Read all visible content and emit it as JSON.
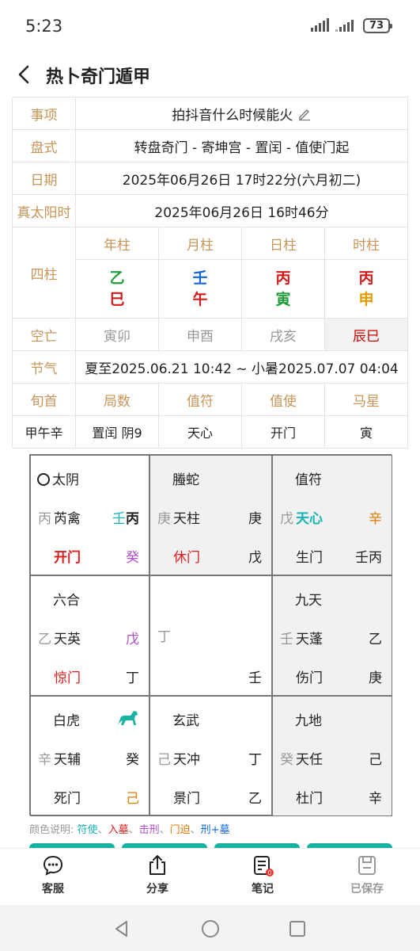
{
  "status": {
    "time": "5:23",
    "battery": "73"
  },
  "header": {
    "title": "热卜奇门遁甲"
  },
  "info": {
    "matter_label": "事项",
    "matter_value": "拍抖音什么时候能火",
    "layout_label": "盘式",
    "layout_value": "转盘奇门 - 寄坤宫 - 置闰 - 值使门起",
    "date_label": "日期",
    "date_value": "2025年06月26日 17时22分(六月初二)",
    "solar_label": "真太阳时",
    "solar_value": "2025年06月26日 16时46分",
    "pillars_label": "四柱",
    "pillar_heads": [
      "年柱",
      "月柱",
      "日柱",
      "时柱"
    ],
    "pillar_stems": [
      "乙",
      "壬",
      "丙",
      "丙"
    ],
    "pillar_branches": [
      "巳",
      "午",
      "寅",
      "申"
    ],
    "void_label": "空亡",
    "voids": [
      "寅卯",
      "申酉",
      "戌亥",
      "辰巳"
    ],
    "term_label": "节气",
    "term_value": "夏至2025.06.21 10:42 ~ 小暑2025.07.07 04:04",
    "lead_label": "旬首",
    "ju_label": "局数",
    "zhifu_label": "值符",
    "zhishi_label": "值使",
    "horse_label": "马星",
    "lead_value": "甲午辛",
    "ju_value": "置闰 阴9",
    "zhifu_value": "天心",
    "zhishi_value": "开门",
    "horse_value": "寅"
  },
  "board": {
    "c1": {
      "god": "太阴",
      "tg": "丙",
      "star": "芮禽",
      "tr1": "壬",
      "tr2": "丙",
      "door": "开门",
      "br": "癸"
    },
    "c2": {
      "god": "螣蛇",
      "tg": "庚",
      "star": "天柱",
      "tr": "庚",
      "door": "休门",
      "br": "戊"
    },
    "c3": {
      "god": "值符",
      "tg": "戊",
      "star": "天心",
      "tr": "辛",
      "door": "生门",
      "br": "壬丙"
    },
    "c4": {
      "god": "六合",
      "tg": "乙",
      "star": "天英",
      "tr": "戊",
      "door": "惊门",
      "br": "丁"
    },
    "c5": {
      "tg": "丁",
      "br": "壬"
    },
    "c6": {
      "god": "九天",
      "tg": "壬",
      "star": "天蓬",
      "tr": "乙",
      "door": "伤门",
      "br": "庚"
    },
    "c7": {
      "god": "白虎",
      "tg": "辛",
      "star": "天辅",
      "tr": "癸",
      "door": "死门",
      "br": "己"
    },
    "c8": {
      "god": "玄武",
      "tg": "己",
      "star": "天冲",
      "tr": "丁",
      "door": "景门",
      "br": "乙"
    },
    "c9": {
      "god": "九地",
      "tg": "癸",
      "star": "天任",
      "tr": "己",
      "door": "杜门",
      "br": "辛"
    }
  },
  "legend": {
    "label": "颜色说明:",
    "a": "符使",
    "b": "入墓",
    "c": "击刑",
    "d": "门迫",
    "e": "刑+墓",
    "sep": "、"
  },
  "nav": {
    "service": "客服",
    "share": "分享",
    "notes": "笔记",
    "saved": "已保存"
  },
  "colors": {
    "gold": "#c89558",
    "teal": "#17b3b3",
    "red": "#e01b1b",
    "purple": "#b14fd1",
    "orange": "#e07a00"
  }
}
